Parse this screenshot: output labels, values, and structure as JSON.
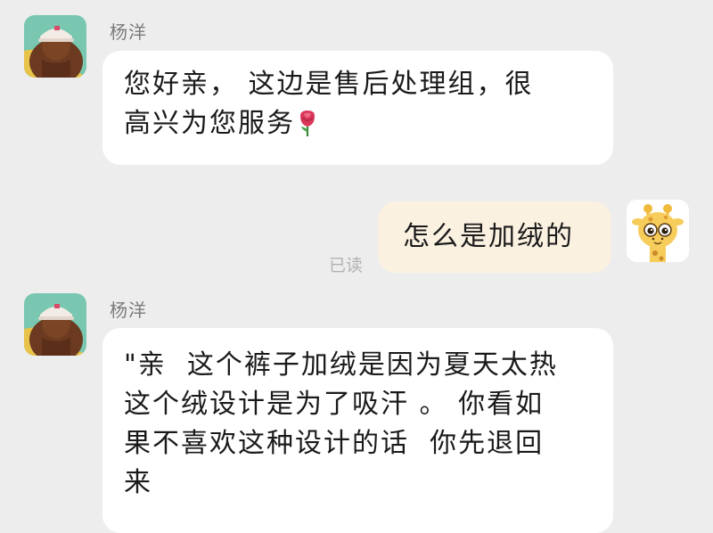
{
  "messages": [
    {
      "sender": "杨洋",
      "text_line1": "您好亲， 这边是售后处理组，很",
      "text_line2": "高兴为您服务",
      "emoji": "rose-emoji"
    },
    {
      "sender": "me",
      "text": "怎么是加绒的",
      "read_status": "已读"
    },
    {
      "sender": "杨洋",
      "lines": [
        "\"亲  这个裤子加绒是因为夏天太热",
        "这个绒设计是为了吸汗 。 你看如",
        "果不喜欢这种设计的话  你先退回",
        "来"
      ]
    }
  ],
  "colors": {
    "background": "#ededed",
    "incoming_bubble": "#ffffff",
    "outgoing_bubble": "#fbf1e1",
    "sender_name": "#7b7b7b",
    "read_receipt": "#b2b2b2"
  },
  "icons": {
    "agent_avatar": "avatar-person-cap-icon",
    "user_avatar": "avatar-giraffe-icon"
  }
}
